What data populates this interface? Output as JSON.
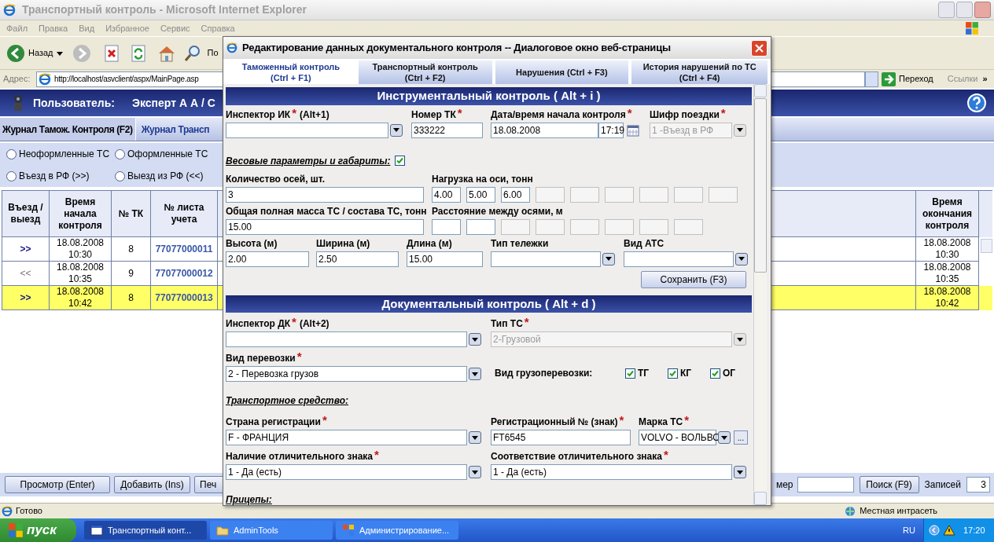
{
  "browser": {
    "title": "Транспортный контроль - Microsoft Internet Explorer",
    "menu": [
      "Файл",
      "Правка",
      "Вид",
      "Избранное",
      "Сервис",
      "Справка"
    ],
    "back_label": "Назад",
    "search_label": "По",
    "address": {
      "label": "Адрес:",
      "url": "http://localhost/asvclient/aspx/MainPage.asp",
      "go": "Переход",
      "links": "Ссылки",
      "more": "»"
    }
  },
  "app": {
    "user_label": "Пользователь:",
    "user_name": "Эксперт А А / С",
    "tabs": [
      {
        "label": "Журнал Тамож. Контроля (F2)",
        "selected": true
      },
      {
        "label": "Журнал Трансп",
        "selected": false
      }
    ],
    "filters": [
      [
        {
          "label": "Неоформленные ТС",
          "selected": false
        },
        {
          "label": "Оформленные ТС",
          "selected": false
        }
      ],
      [
        {
          "label": "Въезд в РФ (>>)",
          "selected": false
        },
        {
          "label": "Выезд из РФ (<<)",
          "selected": false
        }
      ]
    ],
    "table": {
      "columns": [
        "Въезд / выезд",
        "Время начала контроля",
        "№ ТК",
        "№ листа учета",
        "Время окончания контроля"
      ],
      "rows": [
        {
          "direction": ">>",
          "kind": "entry",
          "start": "18.08.2008 10:30",
          "tk": "8",
          "sheet": "77077000011",
          "end": "18.08.2008 10:30",
          "selected": false
        },
        {
          "direction": "<<",
          "kind": "exit",
          "start": "18.08.2008 10:35",
          "tk": "9",
          "sheet": "77077000012",
          "end": "18.08.2008 10:35",
          "selected": false
        },
        {
          "direction": ">>",
          "kind": "entry",
          "start": "18.08.2008 10:42",
          "tk": "8",
          "sheet": "77077000013",
          "end": "18.08.2008 10:42",
          "selected": true
        }
      ]
    },
    "bottom_bar": {
      "buttons": [
        "Просмотр (Enter)",
        "Добавить (Ins)",
        "Печ"
      ],
      "search_label": "мер",
      "search_button": "Поиск (F9)",
      "count_label": "Записей",
      "count": "3"
    }
  },
  "status_bar": {
    "text": "Готово",
    "zone": "Местная интрасеть"
  },
  "taskbar": {
    "start": "пуск",
    "tasks": [
      {
        "label": "Транспортный конт...",
        "selected": true
      },
      {
        "label": "AdminTools",
        "selected": false
      },
      {
        "label": "Администрирование...",
        "selected": false
      }
    ],
    "lang": "RU",
    "clock": "17:20"
  },
  "dialog": {
    "title": "Редактирование данных документального контроля -- Диалоговое окно веб-страницы",
    "tabs": [
      {
        "label": "Таможенный контроль\n(Ctrl + F1)",
        "selected": true
      },
      {
        "label": "Транспортный контроль\n(Ctrl + F2)",
        "selected": false
      },
      {
        "label": "Нарушения (Ctrl + F3)",
        "selected": false
      },
      {
        "label": "История нарушений по ТС\n(Ctrl + F4)",
        "selected": false
      }
    ],
    "instrumental": {
      "title": "Инструментальный контроль ( Alt + i )",
      "inspector": {
        "label": "Инспектор ИК",
        "mark": "*",
        "hint": "(Alt+1)"
      },
      "tk_number": {
        "label": "Номер ТК",
        "mark": "*",
        "value": "333222"
      },
      "start": {
        "label": "Дата/время начала контроля",
        "mark": "*",
        "date": "18.08.2008",
        "time": "17:19"
      },
      "trip_code": {
        "label": "Шифр поездки",
        "mark": "*",
        "value": "1  -Въезд в РФ",
        "disabled": true
      },
      "weights": {
        "label": "Весовые параметры и габариты:",
        "checked": true
      },
      "axle_count": {
        "label": "Количество осей, шт.",
        "value": "3"
      },
      "axle_loads": {
        "label": "Нагрузка на оси, тонн",
        "cells": [
          {
            "value": "4.00",
            "disabled": false
          },
          {
            "value": "5.00",
            "disabled": false
          },
          {
            "value": "6.00",
            "disabled": false
          },
          {
            "disabled": true
          },
          {
            "disabled": true
          },
          {
            "disabled": true
          },
          {
            "disabled": true
          },
          {
            "disabled": true
          },
          {
            "disabled": true
          }
        ]
      },
      "total_mass": {
        "label": "Общая полная масса ТС / состава ТС, тонн",
        "value": "15.00"
      },
      "axle_distances": {
        "label": "Расстояние между осями, м",
        "cells": [
          {
            "disabled": false
          },
          {
            "disabled": false
          },
          {
            "disabled": true
          },
          {
            "disabled": true
          },
          {
            "disabled": true
          },
          {
            "disabled": true
          },
          {
            "disabled": true
          },
          {
            "disabled": true
          }
        ]
      },
      "height": {
        "label": "Высота (м)",
        "value": "2.00"
      },
      "width": {
        "label": "Ширина (м)",
        "value": "2.50"
      },
      "length": {
        "label": "Длина (м)",
        "value": "15.00"
      },
      "bogie_type": {
        "label": "Тип тележки"
      },
      "ats_type": {
        "label": "Вид АТС"
      },
      "save_button": "Сохранить (F3)"
    },
    "documentary": {
      "title": "Документальный контроль ( Alt + d )",
      "inspector": {
        "label": "Инспектор ДК",
        "mark": "*",
        "hint": "(Alt+2)"
      },
      "vehicle_type": {
        "label": "Тип ТС",
        "mark": "*",
        "value": "2-Грузовой",
        "disabled": true
      },
      "transport_kind": {
        "label": "Вид перевозки",
        "mark": "*",
        "value": "2 - Перевозка грузов"
      },
      "cargo_types": {
        "label": "Вид грузоперевозки:",
        "options": [
          {
            "label": "ТГ",
            "checked": true
          },
          {
            "label": "КГ",
            "checked": true
          },
          {
            "label": "ОГ",
            "checked": true
          }
        ]
      },
      "vehicle_heading": "Транспортное средство:",
      "country": {
        "label": "Страна регистрации",
        "mark": "*",
        "value": "F - ФРАНЦИЯ"
      },
      "reg_number": {
        "label": "Регистрационный № (знак)",
        "mark": "*",
        "value": "FT6545"
      },
      "brand": {
        "label": "Марка ТС",
        "mark": "*",
        "value": "VOLVO - ВОЛЬВО",
        "more": "..."
      },
      "sign_present": {
        "label": "Наличие отличительного знака",
        "mark": "*",
        "value": "1 - Да (есть)"
      },
      "sign_match": {
        "label": "Соответствие отличительного знака",
        "mark": "*",
        "value": "1 - Да (есть)"
      },
      "trailers_heading": "Прицепы:"
    }
  }
}
